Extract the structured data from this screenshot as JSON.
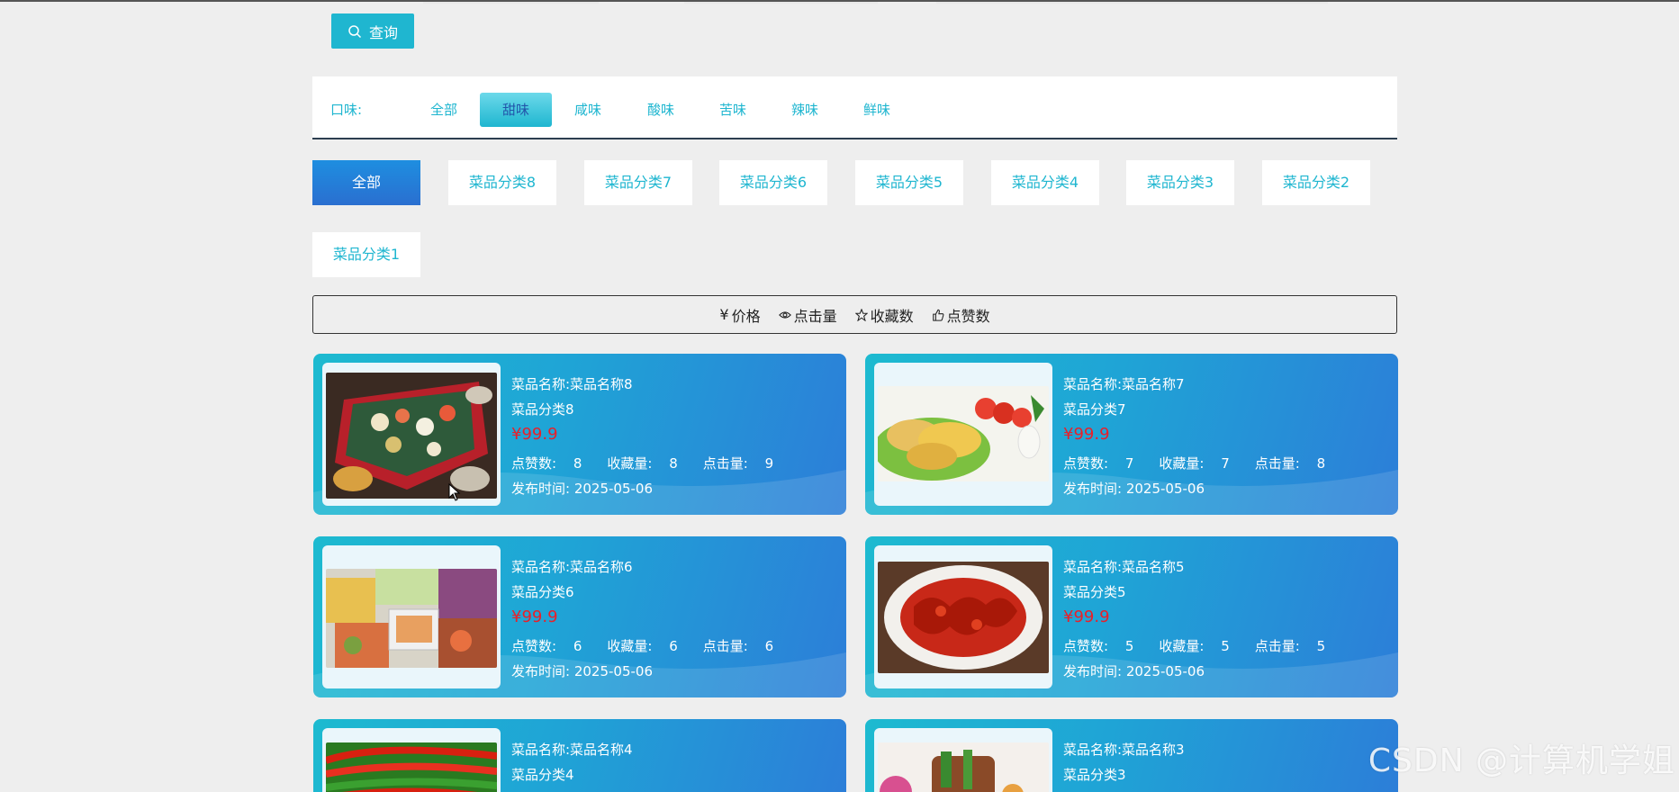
{
  "search": {
    "button_label": "查询"
  },
  "taste": {
    "label": "口味:",
    "items": [
      "全部",
      "甜味",
      "咸味",
      "酸味",
      "苦味",
      "辣味",
      "鲜味"
    ],
    "active": "甜味"
  },
  "categories": {
    "items": [
      "全部",
      "菜品分类8",
      "菜品分类7",
      "菜品分类6",
      "菜品分类5",
      "菜品分类4",
      "菜品分类3",
      "菜品分类2",
      "菜品分类1"
    ],
    "active": "全部"
  },
  "sort": {
    "price": "价格",
    "clicks": "点击量",
    "favorites": "收藏数",
    "likes": "点赞数"
  },
  "cards": [
    {
      "name": "菜品名称:菜品名称8",
      "category": "菜品分类8",
      "price": "¥99.9",
      "likes_label": "点赞数:",
      "likes": "8",
      "fav_label": "收藏量:",
      "fav": "8",
      "click_label": "点击量:",
      "clicks": "9",
      "time_label": "发布时间:",
      "time": "2025-05-06",
      "image": "banquet-photo"
    },
    {
      "name": "菜品名称:菜品名称7",
      "category": "菜品分类7",
      "price": "¥99.9",
      "likes_label": "点赞数:",
      "likes": "7",
      "fav_label": "收藏量:",
      "fav": "7",
      "click_label": "点击量:",
      "clicks": "8",
      "time_label": "发布时间:",
      "time": "2025-05-06",
      "image": "dumplings-salad-photo"
    },
    {
      "name": "菜品名称:菜品名称6",
      "category": "菜品分类6",
      "price": "¥99.9",
      "likes_label": "点赞数:",
      "likes": "6",
      "fav_label": "收藏量:",
      "fav": "6",
      "click_label": "点击量:",
      "clicks": "6",
      "time_label": "发布时间:",
      "time": "2025-05-06",
      "image": "seafood-platter-photo"
    },
    {
      "name": "菜品名称:菜品名称5",
      "category": "菜品分类5",
      "price": "¥99.9",
      "likes_label": "点赞数:",
      "likes": "5",
      "fav_label": "收藏量:",
      "fav": "5",
      "click_label": "点击量:",
      "clicks": "5",
      "time_label": "发布时间:",
      "time": "2025-05-06",
      "image": "crayfish-photo"
    },
    {
      "name": "菜品名称:菜品名称4",
      "category": "菜品分类4",
      "image": "chili-peppers-photo"
    },
    {
      "name": "菜品名称:菜品名称3",
      "category": "菜品分类3",
      "image": "skewers-photo"
    }
  ],
  "watermark": "CSDN @计算机学姐",
  "colors": {
    "accent": "#1fb6d0",
    "card_start": "#1dbad0",
    "card_end": "#2c7ed8",
    "price": "#e8202a"
  }
}
